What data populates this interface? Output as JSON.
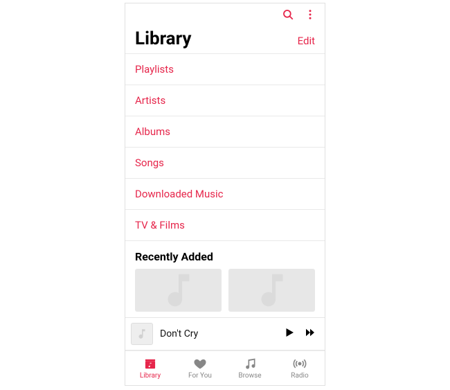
{
  "colors": {
    "accent": "#e6264b"
  },
  "topbar": {
    "search_icon": "search-icon",
    "more_icon": "more-vert-icon"
  },
  "header": {
    "title": "Library",
    "edit_label": "Edit"
  },
  "categories": [
    {
      "label": "Playlists"
    },
    {
      "label": "Artists"
    },
    {
      "label": "Albums"
    },
    {
      "label": "Songs"
    },
    {
      "label": "Downloaded Music"
    },
    {
      "label": "TV & Films"
    }
  ],
  "recent": {
    "section_title": "Recently Added"
  },
  "now_playing": {
    "title": "Don't Cry"
  },
  "tabs": [
    {
      "label": "Library",
      "active": true
    },
    {
      "label": "For You",
      "active": false
    },
    {
      "label": "Browse",
      "active": false
    },
    {
      "label": "Radio",
      "active": false
    }
  ]
}
